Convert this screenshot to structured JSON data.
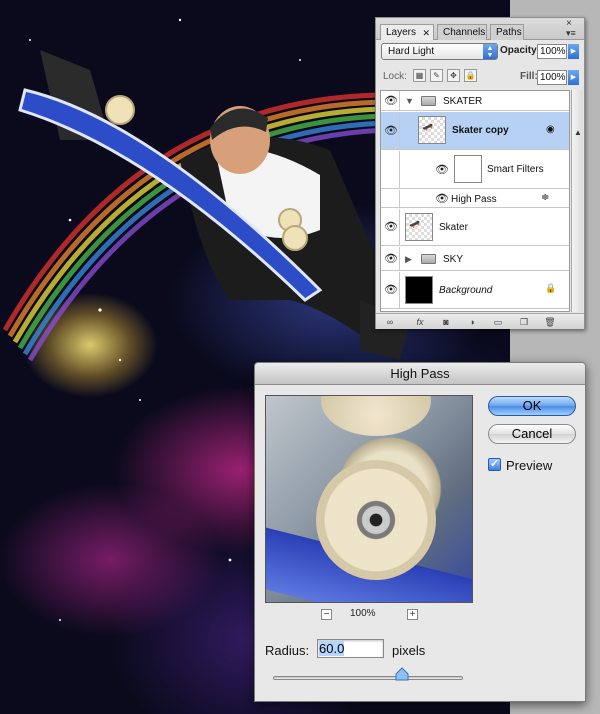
{
  "layers_panel": {
    "tabs": [
      {
        "label": "Layers",
        "active": true
      },
      {
        "label": "Channels",
        "active": false
      },
      {
        "label": "Paths",
        "active": false
      }
    ],
    "blend_mode": "Hard Light",
    "opacity_label": "Opacity:",
    "opacity_value": "100%",
    "lock_label": "Lock:",
    "fill_label": "Fill:",
    "fill_value": "100%",
    "rows": [
      {
        "name": "SKATER",
        "kind": "group",
        "expanded": true
      },
      {
        "name": "Skater copy",
        "kind": "smart-object",
        "selected": true
      },
      {
        "name": "Smart Filters",
        "kind": "smart-filters"
      },
      {
        "name": "High Pass",
        "kind": "filter"
      },
      {
        "name": "Skater",
        "kind": "layer"
      },
      {
        "name": "SKY",
        "kind": "group",
        "expanded": false
      },
      {
        "name": "Background",
        "kind": "background",
        "locked": true
      }
    ]
  },
  "dialog": {
    "title": "High Pass",
    "ok_label": "OK",
    "cancel_label": "Cancel",
    "preview_label": "Preview",
    "preview_checked": true,
    "zoom_level": "100%",
    "radius_label": "Radius:",
    "radius_value": "60.0",
    "radius_unit": "pixels",
    "radius_slider_fraction": 0.68
  },
  "colors": {
    "accent": "#3d82e0",
    "selection": "#b6d1f4"
  }
}
